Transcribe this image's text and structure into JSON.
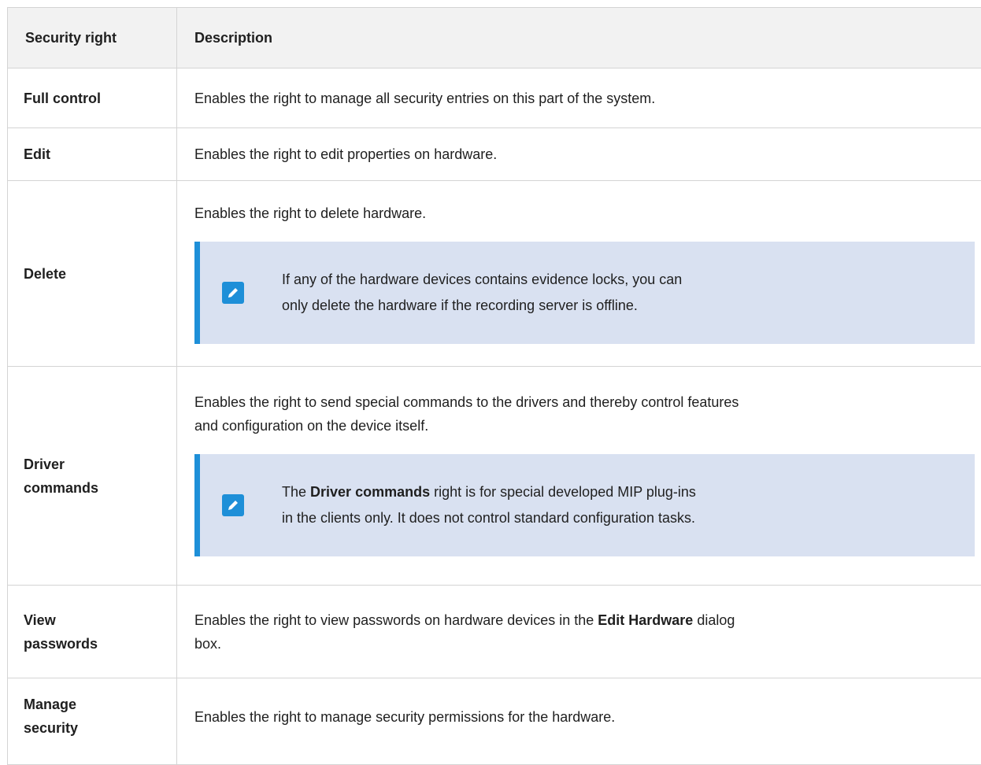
{
  "table": {
    "headers": {
      "right": "Security right",
      "description": "Description"
    },
    "rows": [
      {
        "right": "Full control",
        "description": "Enables the right to manage all security entries on this part of the system."
      },
      {
        "right": "Edit",
        "description": "Enables the right to edit properties on hardware."
      },
      {
        "right": "Delete",
        "description": "Enables the right to delete hardware.",
        "note": {
          "icon": "pencil-note-icon",
          "line1": "If any of the hardware devices contains evidence locks, you can",
          "line2": "only delete the hardware if the recording server is offline."
        }
      },
      {
        "right_line1": "Driver",
        "right_line2": "commands",
        "description_line1": "Enables the right to send special commands to the drivers and thereby control features",
        "description_line2": "and configuration on the device itself.",
        "note": {
          "icon": "pencil-note-icon",
          "line1_pre": "The ",
          "line1_bold": "Driver commands",
          "line1_post": " right is for special developed MIP plug-ins",
          "line2": "in the clients only. It does not control standard configuration tasks."
        }
      },
      {
        "right_line1": "View",
        "right_line2": "passwords",
        "description_pre": "Enables the right to view passwords on hardware devices in the ",
        "description_bold": "Edit Hardware",
        "description_post": " dialog",
        "description_line2": "box."
      },
      {
        "right_line1": "Manage",
        "right_line2": "security",
        "description": "Enables the right to manage security permissions for the hardware."
      }
    ]
  },
  "colors": {
    "note_background": "#d9e1f1",
    "note_accent": "#1e8fd8",
    "header_background": "#f2f2f2",
    "border": "#d4d4d4"
  }
}
